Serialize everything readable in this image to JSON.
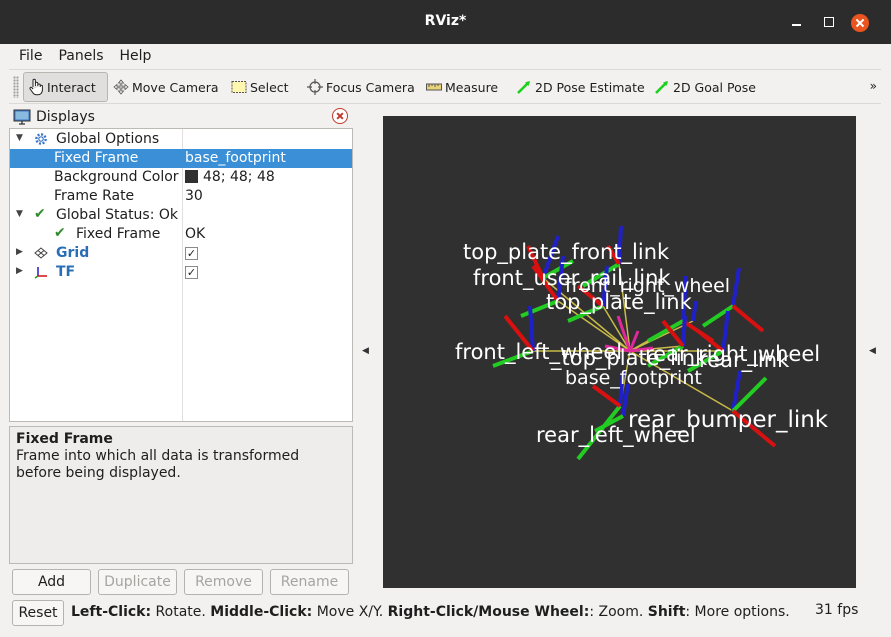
{
  "window": {
    "title": "RViz*"
  },
  "menu": [
    "File",
    "Panels",
    "Help"
  ],
  "toolbar": {
    "interact": "Interact",
    "move_camera": "Move Camera",
    "select": "Select",
    "focus_camera": "Focus Camera",
    "measure": "Measure",
    "pose_estimate": "2D Pose Estimate",
    "goal_pose": "2D Goal Pose",
    "more": "»"
  },
  "displays": {
    "title": "Displays",
    "rows": {
      "global_options": "Global Options",
      "fixed_frame": {
        "name": "Fixed Frame",
        "value": "base_footprint"
      },
      "background_color": {
        "name": "Background Color",
        "value": "48; 48; 48"
      },
      "frame_rate": {
        "name": "Frame Rate",
        "value": "30"
      },
      "global_status": "Global Status: Ok",
      "status_fixed_frame": {
        "name": "Fixed Frame",
        "value": "OK"
      },
      "grid": "Grid",
      "tf": "TF"
    },
    "grid_checked": "✓",
    "tf_checked": "✓"
  },
  "description": {
    "title": "Fixed Frame",
    "text": "Frame into which all data is transformed before being displayed."
  },
  "buttons": {
    "add": "Add",
    "duplicate": "Duplicate",
    "remove": "Remove",
    "rename": "Rename"
  },
  "status": {
    "reset": "Reset",
    "left_click_key": "Left-Click:",
    "left_click_action": " Rotate. ",
    "middle_click_key": "Middle-Click:",
    "middle_click_action": " Move X/Y. ",
    "right_click_key": "Right-Click/Mouse Wheel:",
    "right_click_action": ": Zoom. ",
    "shift_key": "Shift",
    "shift_action": ": More options.",
    "fps": "31 fps"
  },
  "viewport": {
    "background": "#303030",
    "frame_labels": {
      "top_plate_front_link": "top_plate_front_link",
      "front_user_rail": "front_user_rail_link",
      "front_right_wheel": "front_right_wheel",
      "top_plate_link": "top_plate_link",
      "front_left_wheel": "front_left_wheel",
      "top_plate_link_center": "_top_plate_link",
      "rear_right_wheel": "rear_right_wheel",
      "rear_link": "rear_link",
      "base_footprint": "base_footprint",
      "rear_bumper_link": "rear_bumper_link",
      "rear_left_wheel": "rear_left_wheel"
    }
  },
  "colors": {
    "selection": "#3a8fd6",
    "accent_close": "#e95420",
    "x_axis": "#e00000",
    "y_axis": "#00cc00",
    "z_axis": "#0000cc"
  }
}
